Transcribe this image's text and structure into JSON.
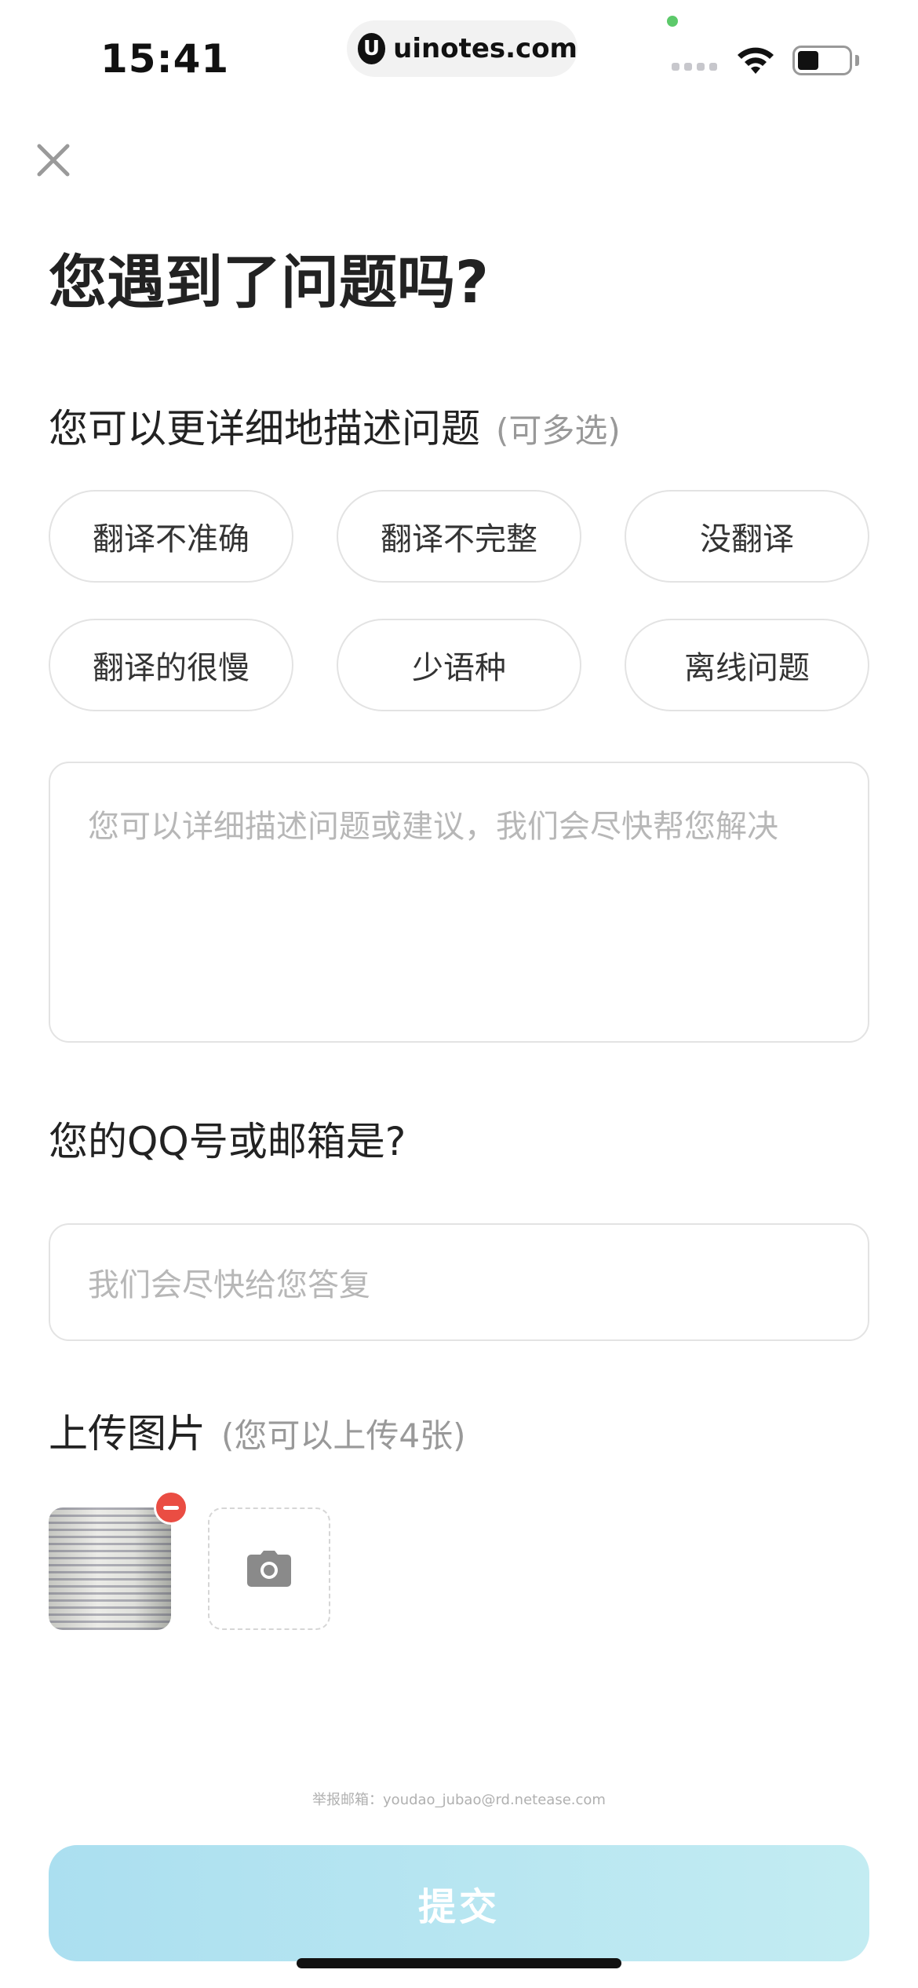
{
  "status_bar": {
    "time": "15:41",
    "url": "uinotes.com",
    "url_logo": "U"
  },
  "page": {
    "title": "您遇到了问题吗?",
    "problem_section": {
      "label": "您可以更详细地描述问题",
      "hint": "(可多选)"
    },
    "chips": [
      "翻译不准确",
      "翻译不完整",
      "没翻译",
      "翻译的很慢",
      "少语种",
      "离线问题"
    ],
    "description_placeholder": "您可以详细描述问题或建议，我们会尽快帮您解决",
    "contact_section": {
      "label": "您的QQ号或邮箱是?"
    },
    "contact_placeholder": "我们会尽快给您答复",
    "upload_section": {
      "label": "上传图片",
      "hint": "(您可以上传4张)"
    },
    "report_email": "举报邮箱：youdao_jubao@rd.netease.com",
    "submit_label": "提交"
  },
  "icons": {
    "close": "close-icon",
    "camera": "camera-icon",
    "remove": "remove-icon"
  },
  "colors": {
    "submit_gradient_start": "#abdff0",
    "submit_gradient_end": "#c3ecf2",
    "remove_badge": "#ea4d43"
  }
}
